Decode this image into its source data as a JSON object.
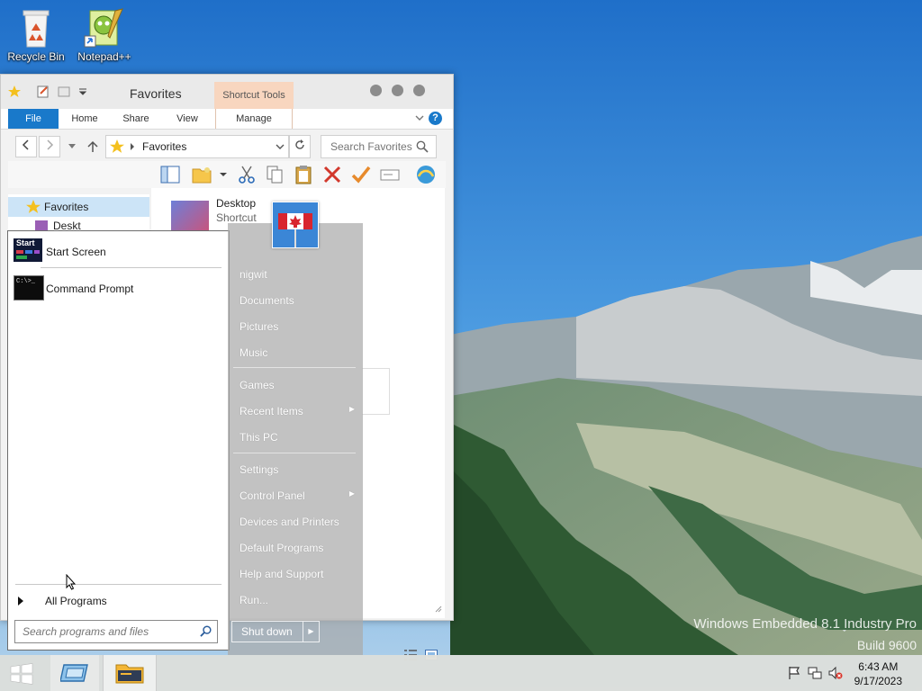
{
  "desktop": {
    "icons": [
      {
        "label": "Recycle Bin"
      },
      {
        "label": "Notepad++"
      }
    ],
    "watermark": {
      "line1": "Windows Embedded 8.1 Industry Pro",
      "line2": "Build 9600"
    }
  },
  "explorer": {
    "title": "Favorites",
    "contextual_tab": "Shortcut Tools",
    "ribbon_tabs": [
      "File",
      "Home",
      "Share",
      "View",
      "Manage"
    ],
    "help_icon": "?",
    "address": "Favorites",
    "search_placeholder": "Search Favorites",
    "nav_pane": {
      "selected": "Favorites",
      "second_item_partial": "Deskt"
    },
    "files": [
      {
        "name": "Desktop",
        "type": "Shortcut"
      }
    ],
    "toolbar_icons": [
      "pane-icon",
      "new-folder-icon",
      "dropdown-icon",
      "cut-icon",
      "copy-icon",
      "paste-icon",
      "delete-icon",
      "checkmark-icon",
      "rename-icon",
      "shell-icon"
    ]
  },
  "start_menu": {
    "pinned": [
      {
        "label": "Start Screen",
        "icon": "start-screen-icon",
        "icon_text": "Start"
      },
      {
        "label": "Command Prompt",
        "icon": "command-prompt-icon",
        "icon_text": "C:\\>_"
      }
    ],
    "all_programs": "All Programs",
    "search_placeholder": "Search programs and files",
    "right_items": [
      {
        "label": "nigwit",
        "arrow": false
      },
      {
        "label": "Documents",
        "arrow": false
      },
      {
        "label": "Pictures",
        "arrow": false
      },
      {
        "label": "Music",
        "arrow": false
      },
      {
        "label": "Games",
        "arrow": false
      },
      {
        "label": "Recent Items",
        "arrow": true
      },
      {
        "label": "This PC",
        "arrow": false
      },
      {
        "label": "Settings",
        "arrow": false
      },
      {
        "label": "Control Panel",
        "arrow": true
      },
      {
        "label": "Devices and Printers",
        "arrow": false
      },
      {
        "label": "Default Programs",
        "arrow": false
      },
      {
        "label": "Help and Support",
        "arrow": false
      },
      {
        "label": "Run...",
        "arrow": false
      }
    ],
    "shutdown_label": "Shut down",
    "arrow_glyph": "▶"
  },
  "taskbar": {
    "start_icon": "windows-logo-icon",
    "tasks": [
      "control-panel-icon",
      "file-explorer-icon"
    ],
    "tray": [
      "flag-icon",
      "network-icon",
      "volume-muted-icon"
    ],
    "time": "6:43 AM",
    "date": "9/17/2023"
  }
}
